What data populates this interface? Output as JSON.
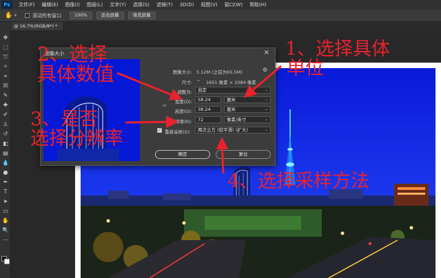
{
  "app": {
    "logo": "Ps"
  },
  "menu": [
    "文件(F)",
    "编辑(E)",
    "图像(I)",
    "图层(L)",
    "文字(Y)",
    "选择(S)",
    "滤镜(T)",
    "3D(D)",
    "视图(V)",
    "窗口(W)",
    "帮助(H)"
  ],
  "options": {
    "scroll_all_label": "滚动所有窗口",
    "btn_100": "100%",
    "btn_fit": "适合屏幕",
    "btn_fill": "填充屏幕"
  },
  "tab": {
    "label": "@ 16.7%(RGB/8*) *"
  },
  "dialog": {
    "title": "图像大小",
    "image_size_label": "图像大小:",
    "image_size_value": "5.12M (之前为65.5M)",
    "dimensions_label": "尺寸:",
    "dimensions_value": "1651 像素 × 1084 像素",
    "fit_label": "调整为:",
    "fit_value": "自定",
    "width_label": "宽度(D):",
    "width_value": "58.24",
    "width_unit": "厘米",
    "height_label": "高度(G):",
    "height_value": "38.24",
    "height_unit": "厘米",
    "resolution_label": "分辨率(R):",
    "resolution_value": "72",
    "resolution_unit": "像素/英寸",
    "resample_label": "重新采样(S):",
    "resample_value": "两次立方 (较平滑) (扩大)",
    "ok_label": "确定",
    "cancel_label": "复位"
  },
  "annotations": {
    "a1_line1": "1、选择具体",
    "a1_line2": "单位",
    "a2_line1": "2、选择",
    "a2_line2": "具体数值",
    "a3_line1": "3、是否",
    "a3_line2": "选择分辨率",
    "a4": "4、选择采样方法"
  },
  "colors": {
    "annotation": "#e8222f",
    "photo_sky": "#0a1fe0",
    "ps_blue": "#31a8ff"
  }
}
